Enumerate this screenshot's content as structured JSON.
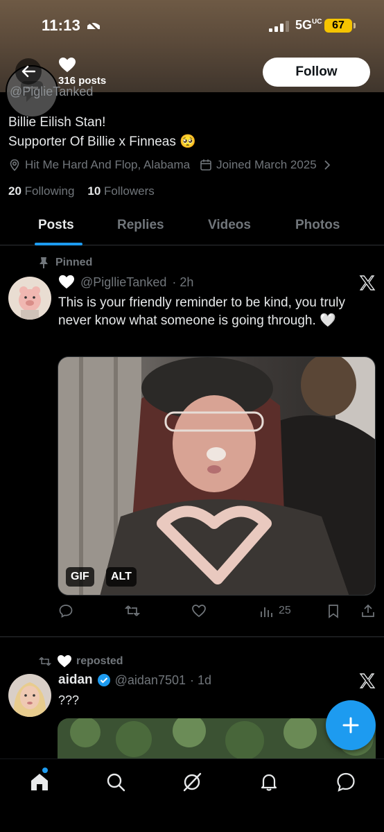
{
  "status_bar": {
    "time": "11:13",
    "network": "5G",
    "network_suffix": "UC",
    "battery": "67"
  },
  "header": {
    "posts_count": "316 posts",
    "follow_label": "Follow",
    "handle_partial": "@PiglieTanked"
  },
  "profile": {
    "bio_line1": "Billie Eilish Stan!",
    "bio_line2": "Supporter Of Billie x Finneas 🥺",
    "location": "Hit Me Hard And Flop, Alabama",
    "joined": "Joined March 2025",
    "following_count": "20",
    "following_label": "Following",
    "followers_count": "10",
    "followers_label": "Followers"
  },
  "tabs": [
    {
      "label": "Posts"
    },
    {
      "label": "Replies"
    },
    {
      "label": "Videos"
    },
    {
      "label": "Photos"
    }
  ],
  "post1": {
    "pinned_label": "Pinned",
    "handle": "@PigllieTanked",
    "time": "· 2h",
    "text": "This is your friendly reminder to be kind, you truly never know what someone is going through. 🤍",
    "badge_gif": "GIF",
    "badge_alt": "ALT",
    "views": "25"
  },
  "post2": {
    "reposted_label": "reposted",
    "name": "aidan",
    "handle": "@aidan7501",
    "time": "· 1d",
    "text": "???"
  },
  "colors": {
    "accent": "#1d9bf0",
    "muted": "#71767b",
    "text": "#e7e9ea",
    "background": "#000000"
  }
}
